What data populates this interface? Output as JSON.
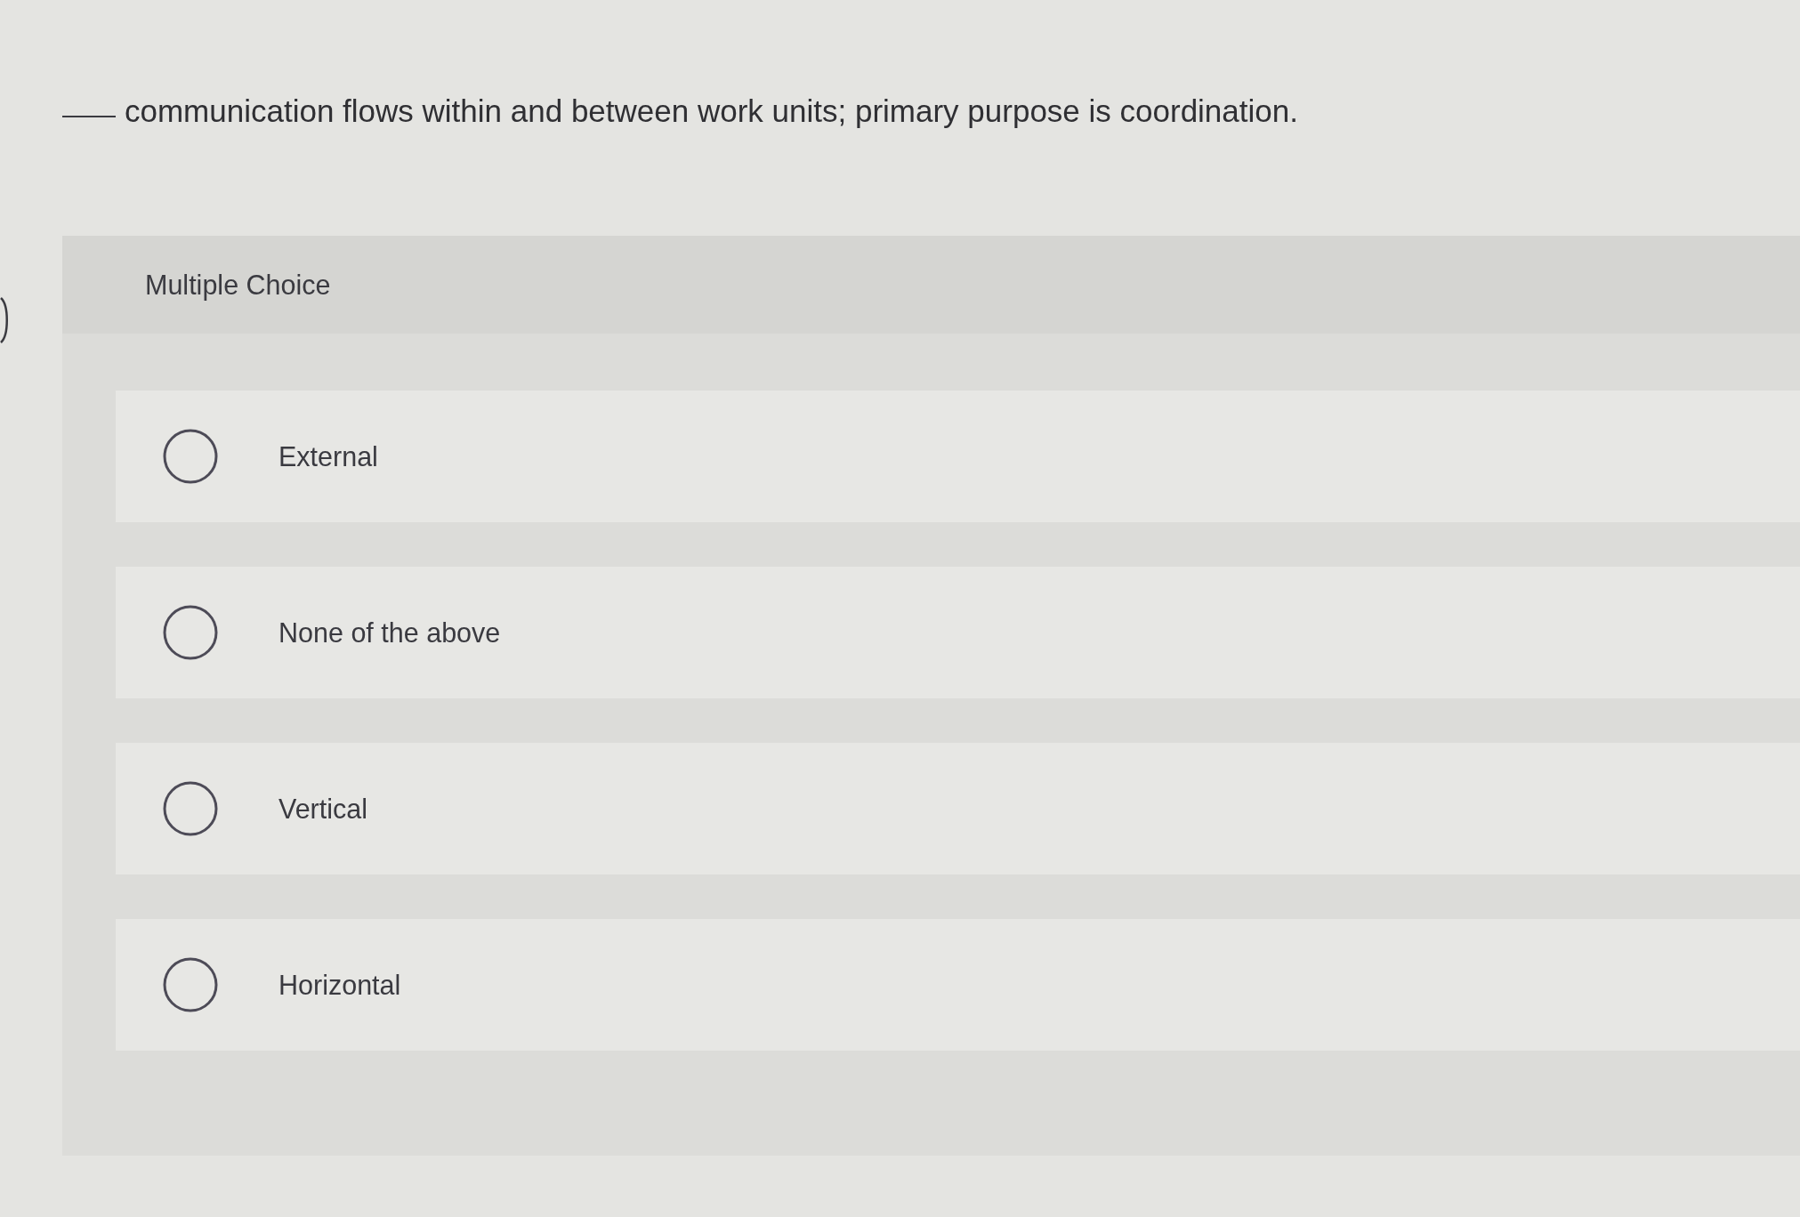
{
  "question": {
    "text": "communication flows within and between work units; primary purpose is coordination."
  },
  "answer_panel": {
    "type_label": "Multiple Choice",
    "options": [
      {
        "label": "External",
        "selected": false
      },
      {
        "label": "None of the above",
        "selected": false
      },
      {
        "label": "Vertical",
        "selected": false
      },
      {
        "label": "Horizontal",
        "selected": false
      }
    ]
  }
}
